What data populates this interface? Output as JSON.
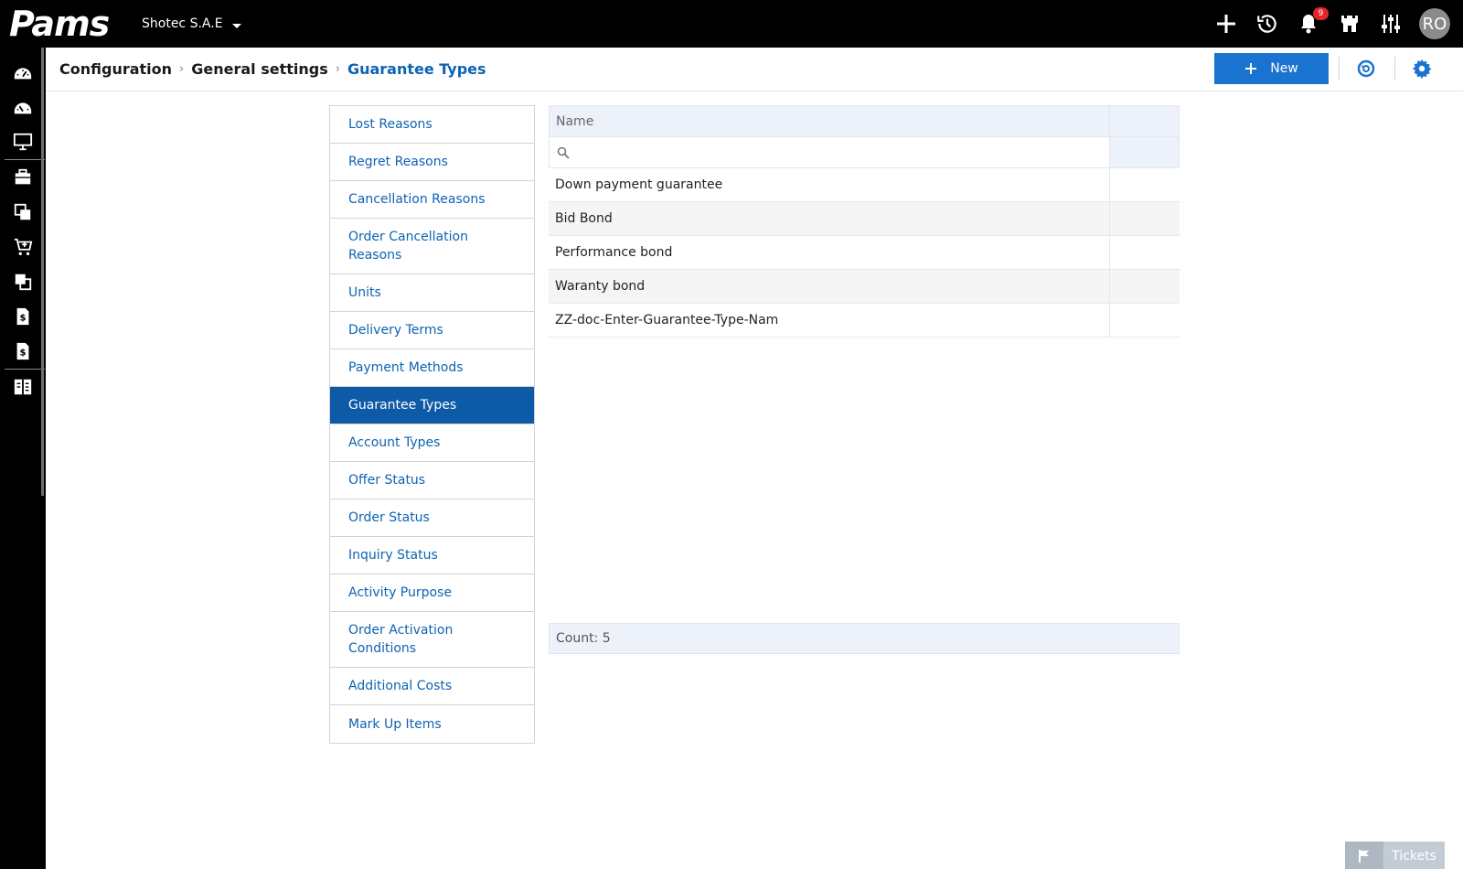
{
  "app": {
    "logo_text": "Pams",
    "company": "Shotec S.A.E"
  },
  "topbar": {
    "icons": [
      "plus-icon",
      "history-icon",
      "bell-icon",
      "castle-icon",
      "sliders-icon"
    ],
    "notifications_count": "9",
    "avatar_initials": "RO"
  },
  "leftrail": {
    "icons": [
      "dashboard-icon",
      "dashboard-alt-icon",
      "monitor-icon",
      "briefcase-icon",
      "documents-icon",
      "cart-icon",
      "documents-alt-icon",
      "invoice-icon",
      "invoice-alt-icon",
      "layout-icon"
    ]
  },
  "breadcrumb": {
    "items": [
      "Configuration",
      "General settings",
      "Guarantee Types"
    ]
  },
  "toolbar": {
    "new_label": "New"
  },
  "settings_menu": {
    "items": [
      "Lost Reasons",
      "Regret Reasons",
      "Cancellation Reasons",
      "Order Cancellation Reasons",
      "Units",
      "Delivery Terms",
      "Payment Methods",
      "Guarantee Types",
      "Account Types",
      "Offer Status",
      "Order Status",
      "Inquiry Status",
      "Activity Purpose",
      "Order Activation Conditions",
      "Additional Costs",
      "Mark Up Items"
    ],
    "selected": "Guarantee Types"
  },
  "grid": {
    "column_name": "Name",
    "filter_placeholder": "",
    "rows": [
      "Down payment guarantee",
      "Bid Bond",
      "Performance bond",
      "Waranty bond",
      "ZZ-doc-Enter-Guarantee-Type-Nam"
    ],
    "count_label": "Count: 5"
  },
  "tickets": {
    "label": "Tickets"
  },
  "colors": {
    "accent": "#1a73d1",
    "selected_bg": "#0d5aa7",
    "link": "#0e63b3",
    "topbar_bg": "#000000",
    "badge": "#e3262d"
  }
}
